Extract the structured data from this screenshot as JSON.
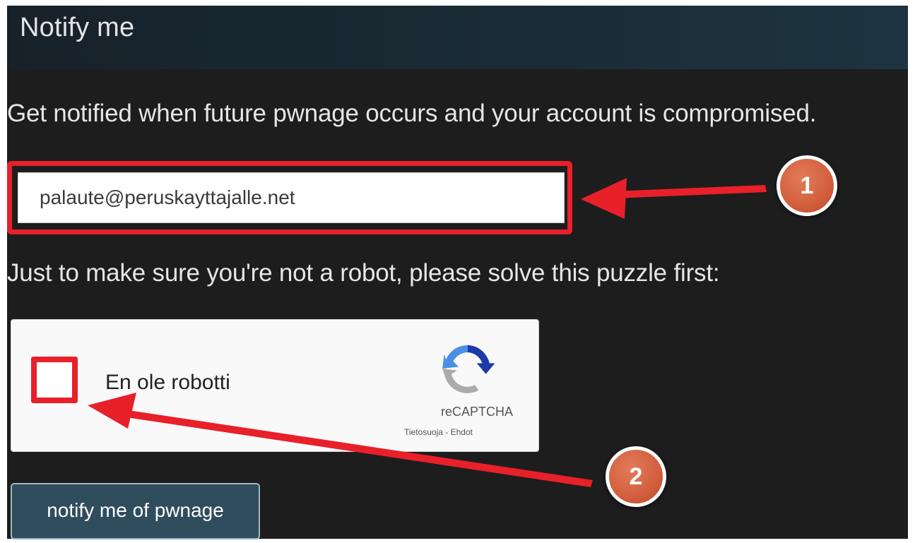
{
  "header": {
    "title": "Notify me"
  },
  "intro": {
    "text": "Get notified when future pwnage occurs and your account is compromised."
  },
  "email": {
    "value": "palaute@peruskayttajalle.net"
  },
  "robot_check": {
    "prompt": "Just to make sure you're not a robot, please solve this puzzle first:"
  },
  "captcha": {
    "checkbox_label": "En ole robotti",
    "brand": "reCAPTCHA",
    "privacy_link": "Tietosuoja",
    "separator": " - ",
    "terms_link": "Ehdot",
    "checked": false
  },
  "submit": {
    "label": "notify me of pwnage"
  },
  "annotations": {
    "step_1": "1",
    "step_2": "2",
    "highlight_color": "#e8202a",
    "badge_color": "#d25f3e"
  },
  "colors": {
    "panel_background": "#1d1d1d",
    "header_background": "#17212a",
    "button_background": "#2f4d5c"
  }
}
